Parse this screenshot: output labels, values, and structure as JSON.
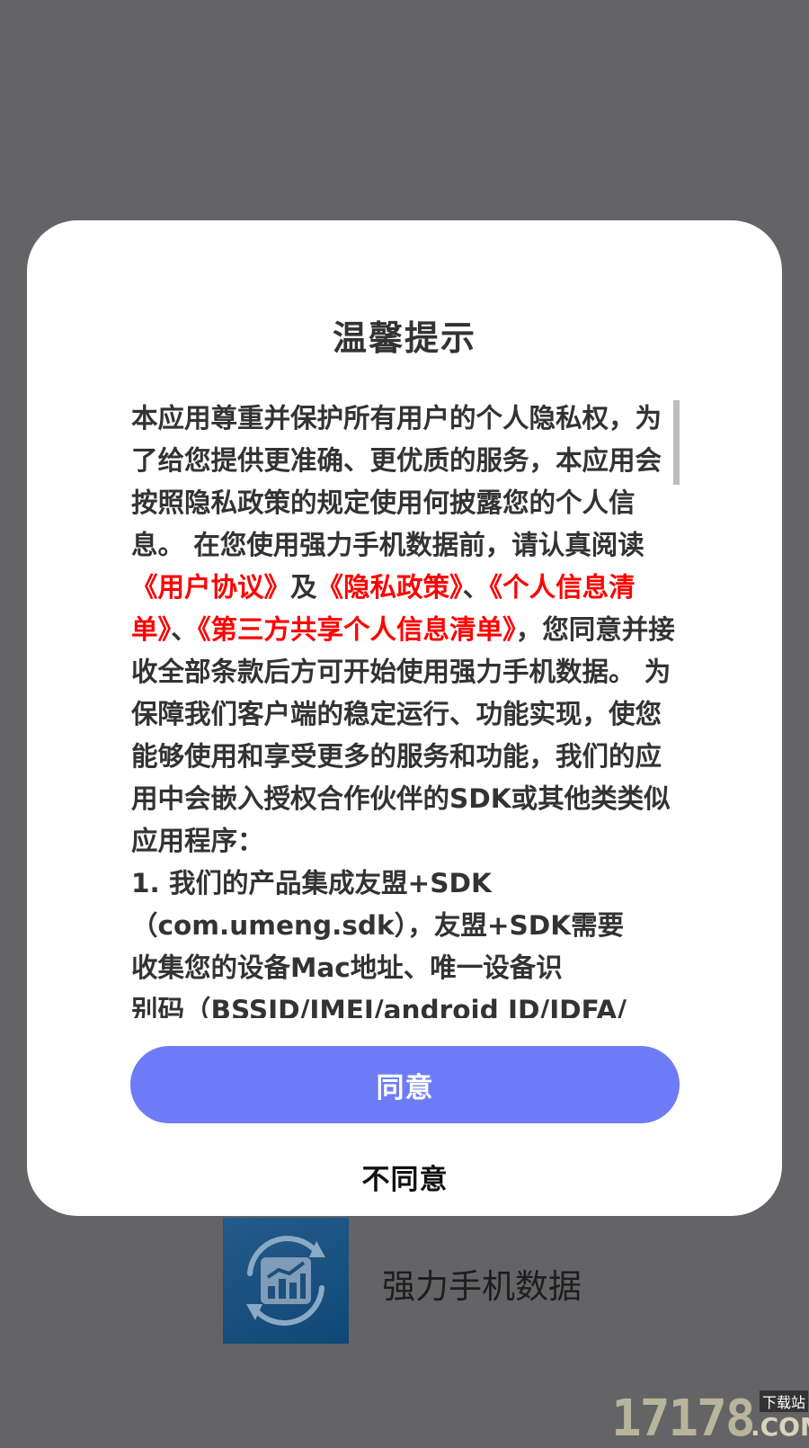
{
  "dialog": {
    "title": "温馨提示",
    "content": {
      "p1": "本应用尊重并保护所有用户的个人隐私权，为了给您提供更准确、更优质的服务，本应用会按照隐私政策的规定使用何披露您的个人信息。 在您使用强力手机数据前，请认真阅读",
      "link_user_agreement": "《用户协议》",
      "and": "及",
      "link_privacy_policy": "《隐私政策》",
      "sep1": "、",
      "link_personal_info_list": "《个人信息清单》",
      "sep2": "、",
      "link_third_party_list": "《第三方共享个人信息清单》",
      "p2": "，您同意并接收全部条款后方可开始使用强力手机数据。 为保障我们客户端的稳定运行、功能实现，使您能够使用和享受更多的服务和功能，我们的应用中会嵌入授权合作伙伴的SDK或其他类类似应用程序：",
      "item1_line1": "1. 我们的产品集成友盟+SDK",
      "item1_line2": "（com.umeng.sdk），友盟+SDK需要",
      "item1_line3": "收集您的设备Mac地址、唯一设备识",
      "item1_line4": "别码（BSSID/IMEI/android ID/IDFA/"
    },
    "agree_label": "同意",
    "disagree_label": "不同意"
  },
  "background": {
    "app_name": "强力手机数据",
    "app_icon": "chart-refresh-icon"
  },
  "watermark": {
    "number": "17178",
    "suffix": ".COM",
    "tag": "下载站"
  },
  "colors": {
    "overlay": "#646467",
    "link": "#ff0000",
    "agree_button": "#6d7cf6"
  }
}
